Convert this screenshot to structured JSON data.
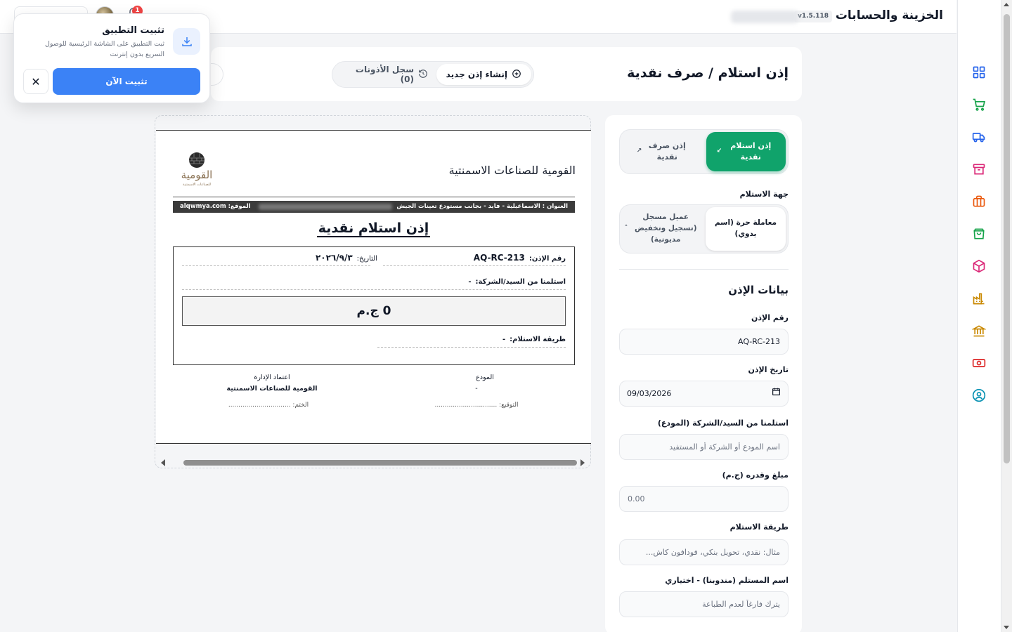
{
  "app": {
    "title": "الخزينة والحسابات",
    "version": "v1.5.118",
    "notification_count": "1"
  },
  "page": {
    "title": "إذن استلام / صرف نقدية",
    "tabs": [
      {
        "label": "إنشاء إذن جديد",
        "active": true
      },
      {
        "label": "سجل الأذونات (0)",
        "active": false
      }
    ]
  },
  "form": {
    "voucher_type": {
      "receive": "إذن استلام نقدية",
      "pay": "إذن صرف نقدية",
      "selected": "receive"
    },
    "source_label": "جهة الاستلام",
    "source": {
      "free": "معاملة حرة (اسم يدوي)",
      "registered": "عميل مسجل (تسجيل وتخفيض مديونية)",
      "selected": "free"
    },
    "section_title": "بيانات الإذن",
    "voucher_no_label": "رقم الإذن",
    "voucher_no_value": "AQ-RC-213",
    "date_label": "تاريخ الإذن",
    "date_value": "09/03/2026",
    "depositor_label": "استلمنا من السيد/الشركة (المودع)",
    "depositor_placeholder": "اسم المودع أو الشركة أو المستفيد",
    "amount_label": "مبلغ وقدره (ج.م)",
    "amount_placeholder": "0.00",
    "method_label": "طريقة الاستلام",
    "method_placeholder": "مثال: نقدي، تحويل بنكي، فودافون كاش...",
    "receiver_label": "اسم المستلم (مندوبنا) - اختياري",
    "receiver_placeholder": "يترك فارغاً لعدم الطباعة"
  },
  "preview": {
    "company_name": "القومية للصناعات الاسمنتية",
    "logo_text": "القومية",
    "logo_subtext": "للصناعات الاسمنتية",
    "address": "العنوان : الاسماعيلية - فايد - بجانب مستودع تعينات الجيش",
    "site": "الموقع: alqwmya.com",
    "doc_title": "إذن استلام نقدية",
    "voucher_no_label": "رقم الإذن:",
    "voucher_no": "AQ-RC-213",
    "date_label": "التاريخ:",
    "date": "٢٠٢٦/٩/٣",
    "received_from_label": "استلمنا من السيد/الشركة:",
    "received_from": "-",
    "amount": "0 ج.م",
    "method_label": "طريقة الاستلام:",
    "method": "-",
    "depositor_title": "المودع",
    "depositor_value": "-",
    "signature_label": "التوقيع: ...............................",
    "management_title": "اعتماد الإدارة",
    "management_value": "القومية للصناعات الاسمنتية",
    "stamp_label": "الختم: ..............................."
  },
  "install_popup": {
    "title": "تثبيت التطبيق",
    "description": "ثبت التطبيق على الشاشة الرئيسية للوصول السريع بدون إنترنت",
    "install_label": "تثبيت الآن"
  },
  "sidebar": {
    "icons": [
      "dashboard-icon",
      "cart-icon",
      "truck-icon",
      "archive-icon",
      "briefcase-icon",
      "shopping-bag-icon",
      "package-icon",
      "factory-icon",
      "bank-icon",
      "cash-icon",
      "user-circle-icon"
    ]
  },
  "colors": {
    "primary_green": "#10a36b",
    "primary_blue": "#3b82f6",
    "badge_red": "#ef4444"
  }
}
